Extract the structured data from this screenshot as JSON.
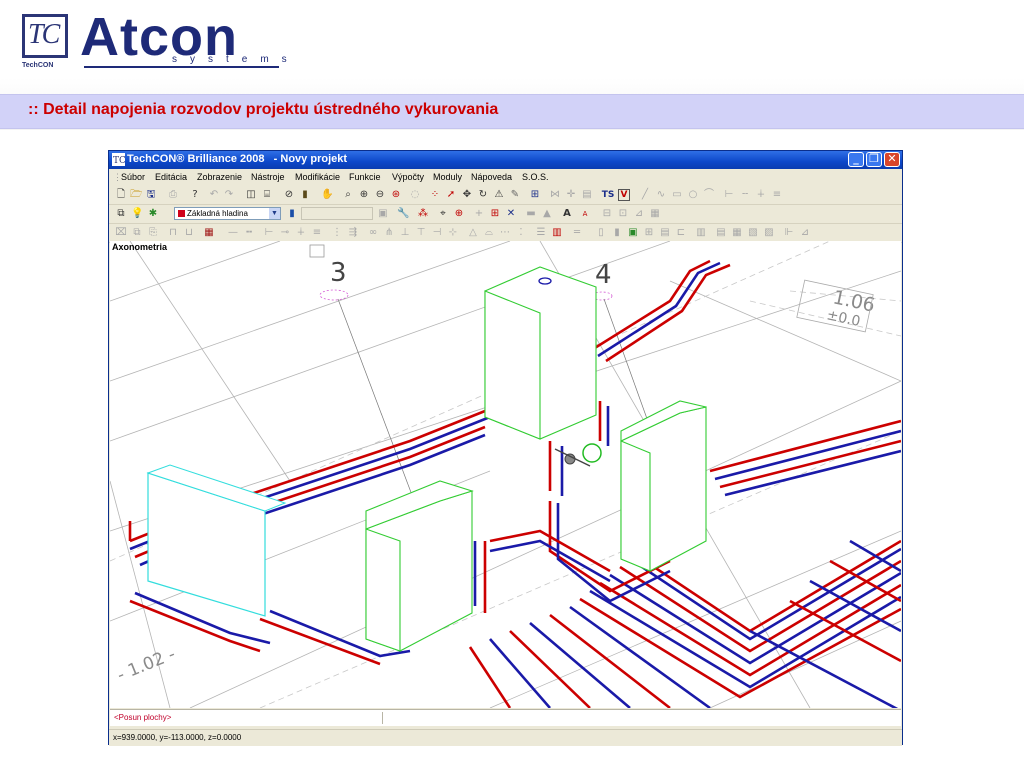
{
  "slide": {
    "logo_tc": "TC",
    "logo_tc_sub": "TechCON",
    "logo_brand": "Atcon",
    "logo_brand_sub": "systems",
    "header_title": ":: Detail napojenia rozvodov projektu ústredného vykurovania"
  },
  "window": {
    "title": "TechCON® Brilliance 2008   - Novy projekt",
    "menu": [
      "Súbor",
      "Editácia",
      "Zobrazenie",
      "Nástroje",
      "Modifikácie",
      "Funkcie",
      "Výpočty",
      "Moduly",
      "Nápoveda",
      "S.O.S."
    ],
    "toolbar_ts": "TS",
    "toolbar_v": "V",
    "layer": "Základná hladina",
    "view_label": "Axonometria",
    "labels": {
      "label_3": "3",
      "label_4": "4",
      "level_106": "1.06",
      "level_000": "±0.0",
      "level_102": "- 1.02 -"
    },
    "command_line": "<Posun plochy>",
    "coordinates": "x=939.0000, y=-113.0000, z=0.0000"
  },
  "colors": {
    "banner_bg": "#d2d2f8",
    "banner_text": "#cc0000",
    "brand": "#1e2a78",
    "supply_pipe": "#cc0000",
    "return_pipe": "#1a1aa8",
    "radiator_edge": "#33cc33"
  }
}
